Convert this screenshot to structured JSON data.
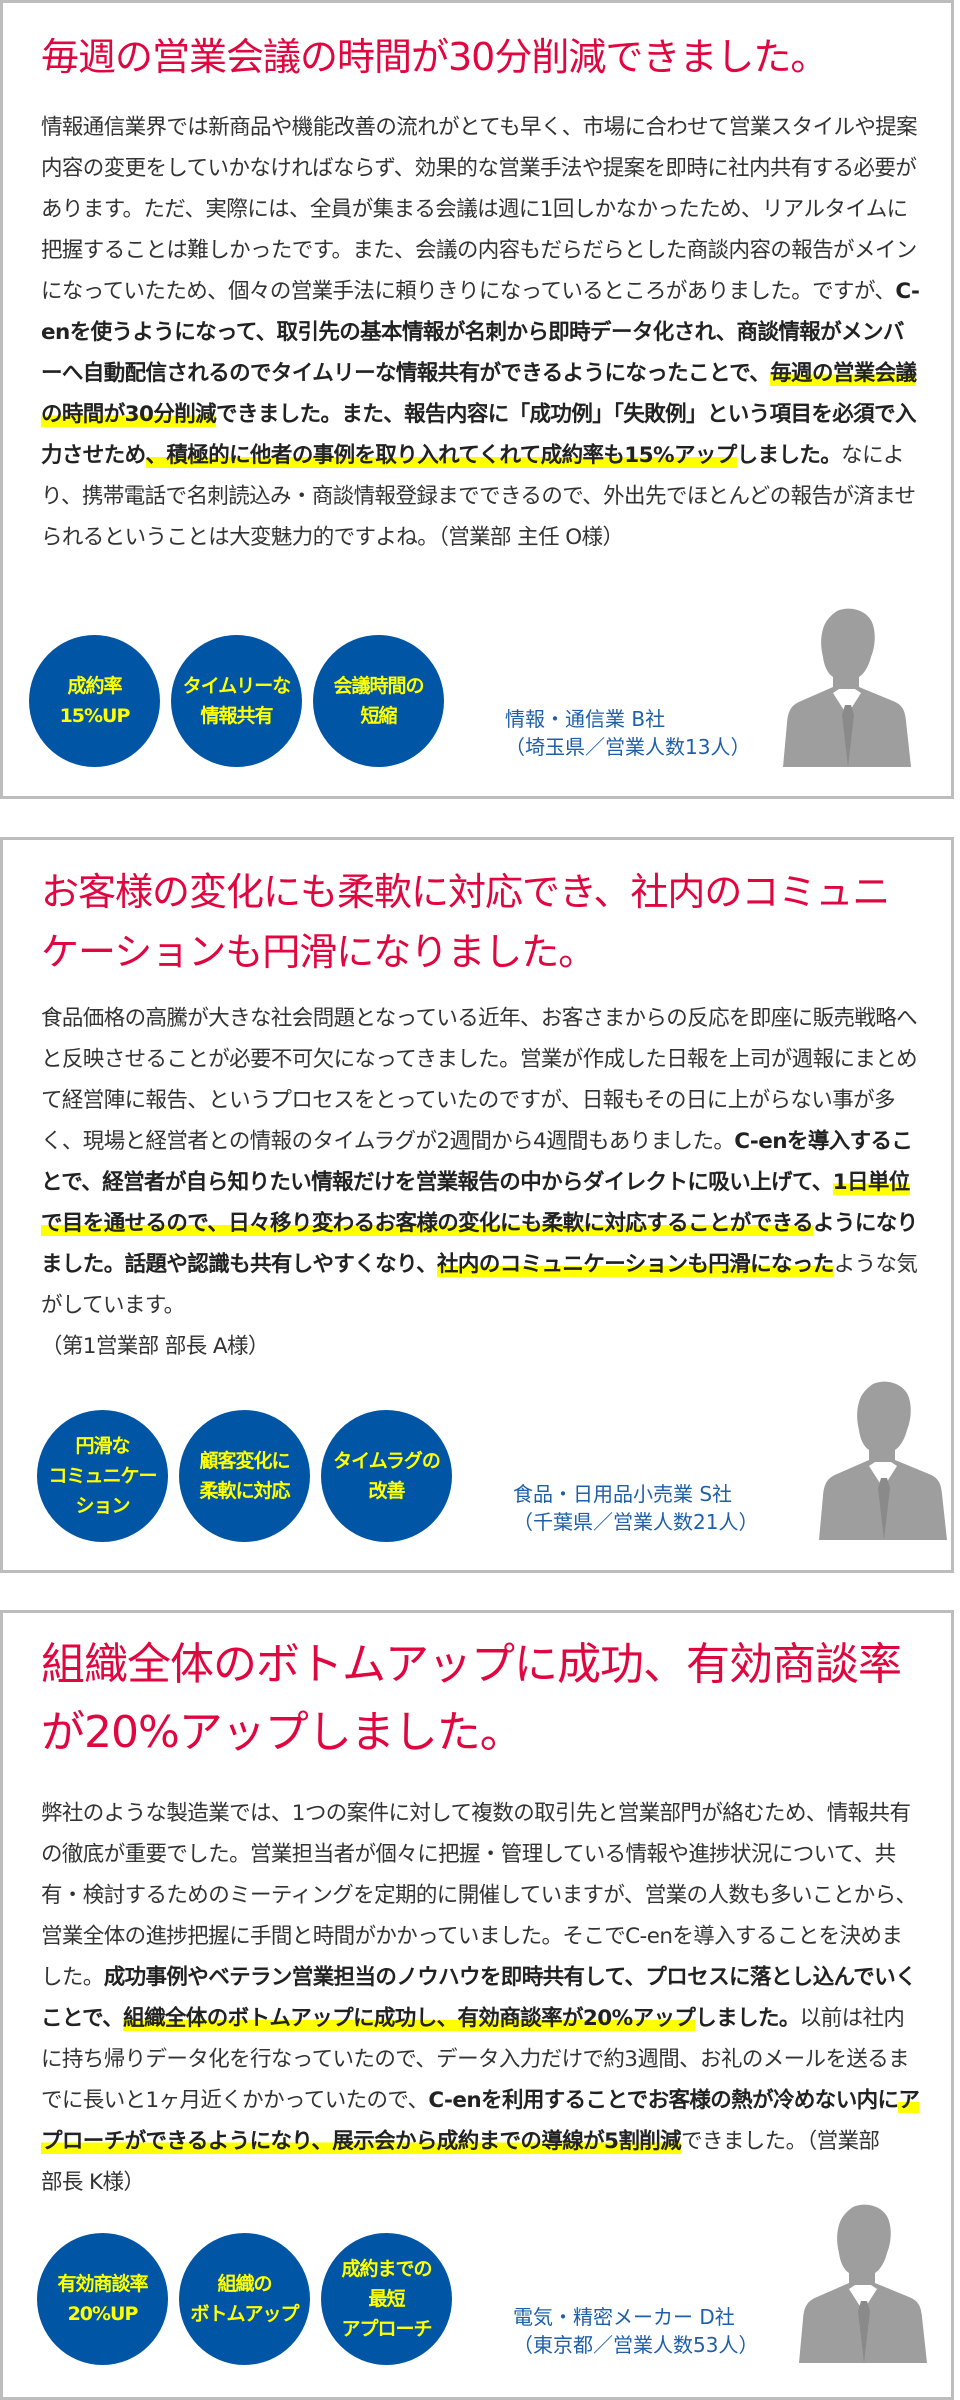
{
  "colors": {
    "title": "#e0063f",
    "circle": "#0055a4",
    "circle_text": "#ffff00",
    "company": "#1f5fa8",
    "highlight": "#ffff00",
    "silhouette": "#9e9e9e"
  },
  "cards": [
    {
      "title": "毎週の営業会議の時間が30分削減できました。",
      "body": [
        {
          "t": "情報通信業界では新商品や機能改善の流れがとても早く、市場に合わせて営業スタイルや提案内容の変更をしていかなければならず、効果的な営業手法や提案を即時に社内共有する必要があります。ただ、実際には、全員が集まる会議は週に1回しかなかったため、リアルタイムに把握することは難しかったです。また、会議の内容もだらだらとした商談内容の報告がメインになっていたため、個々の営業手法に頼りきりになっているところがありました。ですが、",
          "s": ""
        },
        {
          "t": "C-enを使うようになって、取引先の基本情報が名刺から即時データ化され、商談情報がメンバーへ自動配信されるのでタイムリーな情報共有ができるようになったことで、",
          "s": "b"
        },
        {
          "t": "毎週の営業会議の時間が30分削減",
          "s": "b hl"
        },
        {
          "t": "できました。また、報告内容に「成功例」「失敗例」という項目を必須で入力させため",
          "s": "b"
        },
        {
          "t": "、積極的に他者の事例を取り入れてくれて成約率も15%アップ",
          "s": "b hl"
        },
        {
          "t": "しました。",
          "s": "b"
        },
        {
          "t": "なにより、携帯電話で名刺読込み・商談情報登録までできるので、外出先でほとんどの報告が済ませられるということは大変魅力的ですよね。（営業部 主任 O様）",
          "s": ""
        }
      ],
      "attribution": "",
      "badges": [
        [
          "成約率",
          "15%UP"
        ],
        [
          "タイムリーな",
          "情報共有"
        ],
        [
          "会議時間の",
          "短縮"
        ]
      ],
      "company": [
        "情報・通信業 B社",
        "（埼玉県／営業人数13人）"
      ]
    },
    {
      "title": "お客様の変化にも柔軟に対応でき、社内のコミュニケーションも円滑になりました。",
      "body": [
        {
          "t": "食品価格の高騰が大きな社会問題となっている近年、お客さまからの反応を即座に販売戦略へと反映させることが必要不可欠になってきました。営業が作成した日報を上司が週報にまとめて経営陣に報告、というプロセスをとっていたのですが、日報もその日に上がらない事が多く、現場と経営者との情報のタイムラグが2週間から4週間もありました。",
          "s": ""
        },
        {
          "t": "C-enを導入することで、経営者が自ら知りたい情報だけを営業報告の中からダイレクトに吸い上げて、",
          "s": "b"
        },
        {
          "t": "1日単位で目を通せるので、日々移り変わるお客様の変化にも柔軟に対応することができる",
          "s": "b hl"
        },
        {
          "t": "ようになりました。話題や認識も共有しやすくなり、",
          "s": "b"
        },
        {
          "t": "社内のコミュニケーションも円滑になった",
          "s": "b hl"
        },
        {
          "t": "ような気がしています。",
          "s": ""
        }
      ],
      "attribution": "（第1営業部 部長 A様）",
      "badges": [
        [
          "円滑な",
          "コミュニケー",
          "ション"
        ],
        [
          "顧客変化に",
          "柔軟に対応"
        ],
        [
          "タイムラグの",
          "改善"
        ]
      ],
      "company": [
        "食品・日用品小売業 S社",
        "（千葉県／営業人数21人）"
      ]
    },
    {
      "title": "組織全体のボトムアップに成功、有効商談率が20%アップしました。",
      "body": [
        {
          "t": "弊社のような製造業では、1つの案件に対して複数の取引先と営業部門が絡むため、情報共有の徹底が重要でした。営業担当者が個々に把握・管理している情報や進捗状況について、共有・検討するためのミーティングを定期的に開催していますが、営業の人数も多いことから、営業全体の進捗把握に手間と時間がかかっていました。そこでC-enを導入することを決めました。",
          "s": ""
        },
        {
          "t": "成功事例やベテラン営業担当のノウハウを即時共有して、プロセスに落とし込んでいくことで、",
          "s": "b"
        },
        {
          "t": "組織全体のボトムアップに成功し、有効商談率が20%アップ",
          "s": "b hl"
        },
        {
          "t": "しました。",
          "s": "b"
        },
        {
          "t": "以前は社内に持ち帰りデータ化を行なっていたので、データ入力だけで約3週間、お礼のメールを送るまでに長いと1ヶ月近くかかっていたので、",
          "s": ""
        },
        {
          "t": "C-enを利用することでお客様の熱が冷めない内に",
          "s": "b"
        },
        {
          "t": "アプローチができるようになり、展示会から成約までの導線が5割削減",
          "s": "b hl"
        },
        {
          "t": "できました。（営業部　部長 K様）",
          "s": ""
        }
      ],
      "attribution": "",
      "badges": [
        [
          "有効商談率",
          "20%UP"
        ],
        [
          "組織の",
          "ボトムアップ"
        ],
        [
          "成約までの",
          "最短",
          "アプローチ"
        ]
      ],
      "company": [
        "電気・精密メーカー D社",
        "（東京都／営業人数53人）"
      ]
    }
  ]
}
